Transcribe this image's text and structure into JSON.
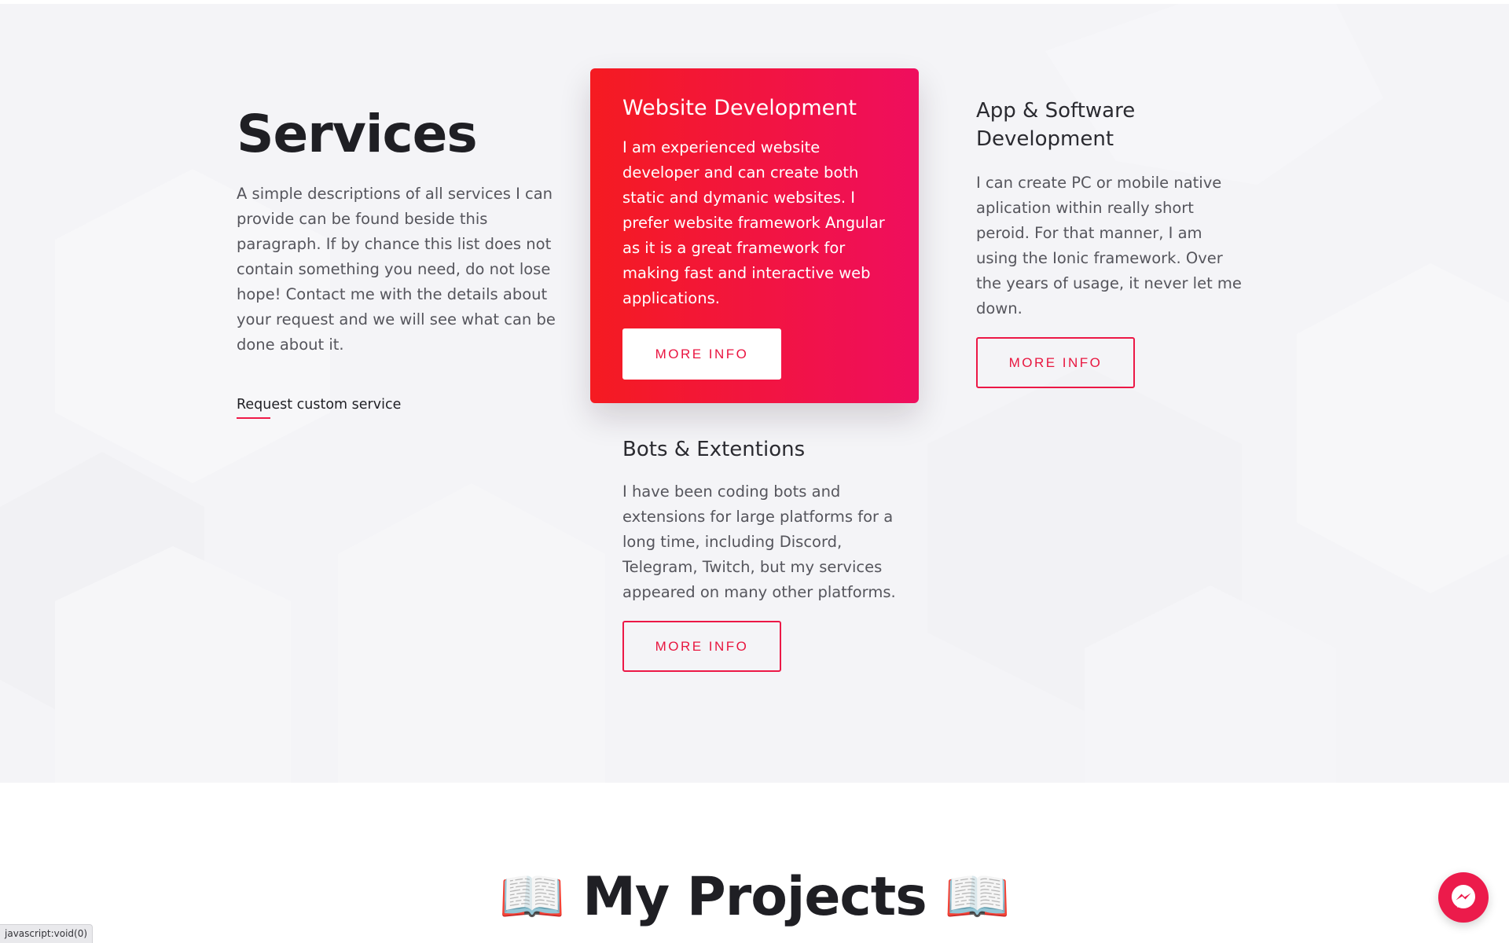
{
  "services": {
    "title": "Services",
    "description": "A simple descriptions of all services I can provide can be found beside this paragraph. If by chance this list does not contain something you need, do not lose hope! Contact me with the details about your request and we will see what can be done about it.",
    "custom_link": "Request custom service",
    "cards": [
      {
        "title": "Website Development",
        "text": "I am experienced website developer and can create both static and dymanic websites. I prefer website framework Angular as it is a great framework for making fast and interactive web applications.",
        "button": "MORE INFO",
        "featured": true
      },
      {
        "title": "App & Software Development",
        "text": "I can create PC or mobile native aplication within really short peroid. For that manner, I am using the Ionic framework. Over the years of usage, it never let me down.",
        "button": "MORE INFO"
      },
      {
        "title": "Bots & Extentions",
        "text": "I have been coding bots and extensions for large platforms for a long time, including Discord, Telegram, Twitch, but my services appeared on many other platforms.",
        "button": "MORE INFO"
      }
    ]
  },
  "projects": {
    "title": "📖 My Projects 📖"
  },
  "status_bar": {
    "text": "javascript:void(0)"
  },
  "messenger": {
    "icon": "messenger-icon"
  },
  "colors": {
    "accent": "#ec1846",
    "gradient_start": "#f51b21",
    "gradient_end": "#ef0e5e",
    "section_background": "#f4f4f7"
  }
}
